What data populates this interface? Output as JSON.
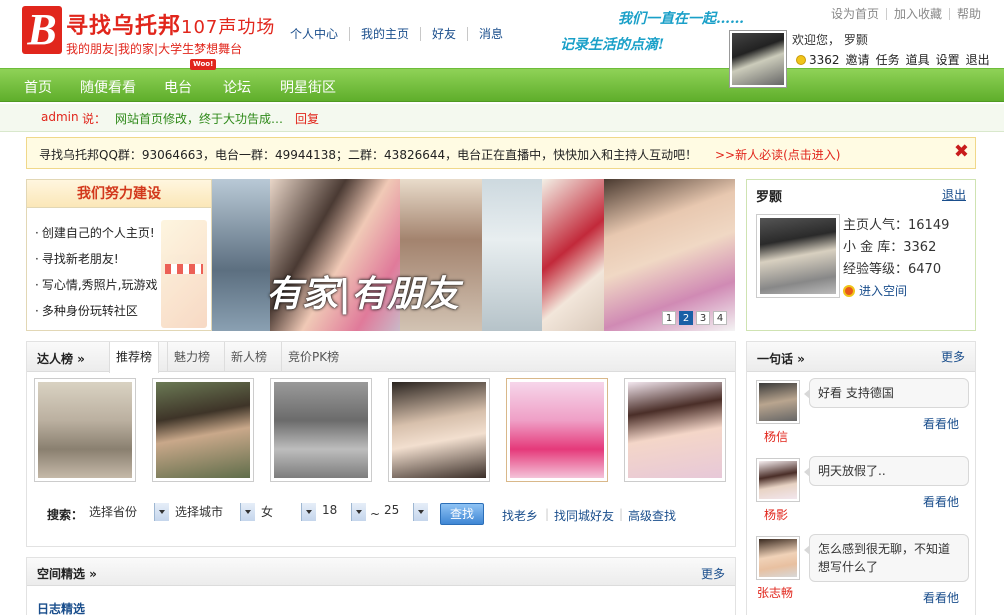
{
  "logo": {
    "title": "寻找乌托邦",
    "sub_title": "107声功场",
    "tagline": "我的朋友|我的家|大学生梦想舞台"
  },
  "topnav": [
    "个人中心",
    "我的主页",
    "好友",
    "消息"
  ],
  "slogan": {
    "line1": "我们一直在一起……",
    "line2": "记录生活的点滴!"
  },
  "toplinks": [
    "设为首页",
    "加入收藏",
    "帮助"
  ],
  "welcome": "欢迎您， 罗颢",
  "user_links": {
    "coins": "3362",
    "items": [
      "邀请",
      "任务",
      "道具",
      "设置",
      "退出"
    ]
  },
  "mainnav": {
    "items": [
      "首页",
      "随便看看",
      "电台",
      "论坛",
      "明星街区"
    ],
    "new_tag": "Woo!"
  },
  "notice": {
    "who": "admin",
    "says": "说：",
    "message": "网站首页修改，终于大功告成…",
    "reply": "回复"
  },
  "qqbar": {
    "text": "寻找乌托邦QQ群：93064663，电台一群：49944138；二群：43826644，电台正在直播中，快快加入和主持人互动吧！",
    "newbie": ">>新人必读(点击进入)",
    "close": "✖"
  },
  "build": {
    "title": "我们努力建设",
    "items": [
      "创建自己的个人主页!",
      "寻找新老朋友!",
      "写心情,秀照片,玩游戏",
      "多种身份玩转社区"
    ]
  },
  "banner": {
    "caption": "有家|有朋友",
    "pages": [
      "1",
      "2",
      "3",
      "4"
    ],
    "current_page": 1
  },
  "usercard": {
    "name": "罗颢",
    "logout": "退出",
    "stats": [
      "主页人气：16149",
      "小 金 库：3362",
      "经验等级：6470"
    ],
    "enter": "进入空间"
  },
  "rank": {
    "label": "达人榜 »",
    "tabs": [
      "推荐榜",
      "魅力榜",
      "新人榜",
      "竞价PK榜"
    ],
    "active_tab": "推荐榜"
  },
  "search": {
    "label": "搜索：",
    "province": "选择省份",
    "city": "选择城市",
    "gender": "女",
    "age_from": "18",
    "tilde": "~",
    "age_to": "25",
    "button": "查找",
    "links": [
      "找老乡",
      "找同城好友",
      "高级查找"
    ]
  },
  "picks": {
    "title": "空间精选 »",
    "more": "更多",
    "sub": "日志精选"
  },
  "onesent": {
    "title": "一句话 »",
    "more": "更多",
    "see_label": "看看他",
    "entries": [
      {
        "name": "杨信",
        "text": "好看  支持德国"
      },
      {
        "name": "杨影",
        "text": "明天放假了.."
      },
      {
        "name": "张志畅",
        "text": "怎么感到很无聊，不知道想写什么了"
      }
    ]
  }
}
